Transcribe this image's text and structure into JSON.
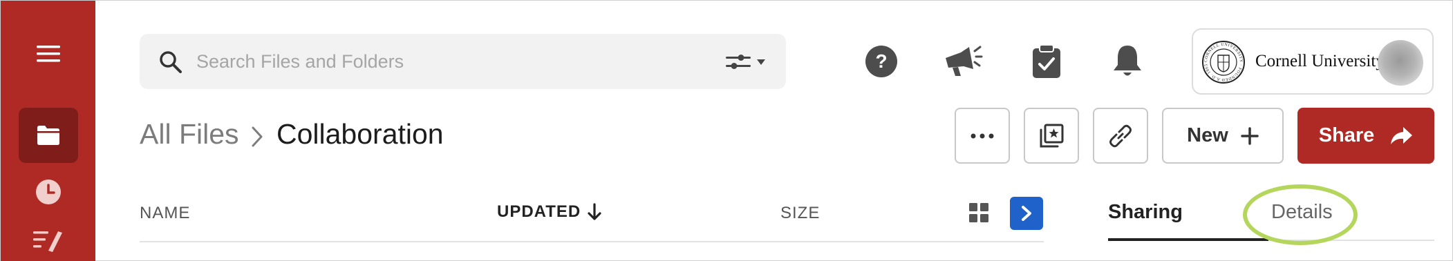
{
  "sidebar": {
    "menu_icon": "hamburger-menu-icon",
    "items": [
      {
        "name": "files",
        "icon": "folder-icon",
        "active": true
      },
      {
        "name": "recents",
        "icon": "clock-icon",
        "active": false
      },
      {
        "name": "notes",
        "icon": "notes-pen-icon",
        "active": false
      }
    ],
    "background": "#b02a25",
    "active_background": "#7e1d1a"
  },
  "search": {
    "placeholder": "Search Files and Folders",
    "value": "",
    "search_icon": "search-icon",
    "filter_icon": "sliders-filter-icon"
  },
  "header_icons": [
    "help-icon",
    "announcements-icon",
    "tasks-clipboard-icon",
    "notifications-bell-icon"
  ],
  "org": {
    "name": "Cornell University",
    "seal": "cornell-seal-logo",
    "seal_text": "CORNELL UNIVERSITY · FOUNDED A.D. 1865"
  },
  "breadcrumb": {
    "root": "All Files",
    "current": "Collaboration"
  },
  "actions": {
    "more_icon": "more-options-icon",
    "collections_icon": "add-to-collections-icon",
    "link_icon": "copy-link-icon",
    "new_label": "New",
    "share_label": "Share"
  },
  "columns": {
    "name": "NAME",
    "updated": "UPDATED",
    "size": "SIZE",
    "sort": "descending"
  },
  "details_panel": {
    "tabs": [
      {
        "label": "Sharing",
        "active": true
      },
      {
        "label": "Details",
        "active": false
      }
    ]
  },
  "colors": {
    "brand_red": "#b02a25",
    "accent_blue": "#1f62c9",
    "highlight": "#b5d65c"
  }
}
